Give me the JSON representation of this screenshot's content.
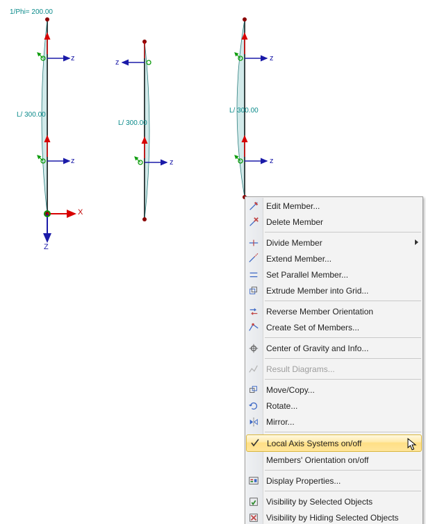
{
  "viewport": {
    "labels": {
      "phi": "1/Phi= 200.00",
      "l1": "L/ 300.00",
      "l2": "L/ 300.00",
      "l3": "L/ 300.00"
    },
    "axes": {
      "x": "X",
      "z": "Z",
      "zlocal": "z"
    }
  },
  "menu": {
    "items": [
      {
        "key": "edit-member",
        "label": "Edit Member...",
        "icon": "edit-member-icon"
      },
      {
        "key": "delete-member",
        "label": "Delete Member",
        "icon": "delete-member-icon"
      },
      {
        "sep": true
      },
      {
        "key": "divide-member",
        "label": "Divide Member",
        "icon": "divide-icon",
        "submenu": true
      },
      {
        "key": "extend-member",
        "label": "Extend Member...",
        "icon": "extend-icon"
      },
      {
        "key": "set-parallel",
        "label": "Set Parallel Member...",
        "icon": "parallel-icon"
      },
      {
        "key": "extrude",
        "label": "Extrude Member into Grid...",
        "icon": "extrude-icon"
      },
      {
        "sep": true
      },
      {
        "key": "reverse",
        "label": "Reverse Member Orientation",
        "icon": "reverse-icon"
      },
      {
        "key": "createset",
        "label": "Create Set of Members...",
        "icon": "createset-icon"
      },
      {
        "sep": true
      },
      {
        "key": "cog",
        "label": "Center of Gravity and Info...",
        "icon": "cog-icon"
      },
      {
        "sep": true
      },
      {
        "key": "result",
        "label": "Result Diagrams...",
        "icon": "result-icon",
        "disabled": true
      },
      {
        "sep": true
      },
      {
        "key": "movecopy",
        "label": "Move/Copy...",
        "icon": "movecopy-icon"
      },
      {
        "key": "rotate",
        "label": "Rotate...",
        "icon": "rotate-icon"
      },
      {
        "key": "mirror",
        "label": "Mirror...",
        "icon": "mirror-icon"
      },
      {
        "sep": true
      },
      {
        "key": "localaxis",
        "label": "Local Axis Systems on/off",
        "checked": true,
        "highlight": true
      },
      {
        "key": "membersorient",
        "label": "Members' Orientation on/off"
      },
      {
        "sep": true
      },
      {
        "key": "displayprops",
        "label": "Display Properties...",
        "icon": "displayprops-icon"
      },
      {
        "sep": true
      },
      {
        "key": "visbysel",
        "label": "Visibility by Selected Objects",
        "icon": "visbysel-icon"
      },
      {
        "key": "visbyhide",
        "label": "Visibility by Hiding Selected Objects",
        "icon": "visbyhide-icon"
      }
    ]
  }
}
